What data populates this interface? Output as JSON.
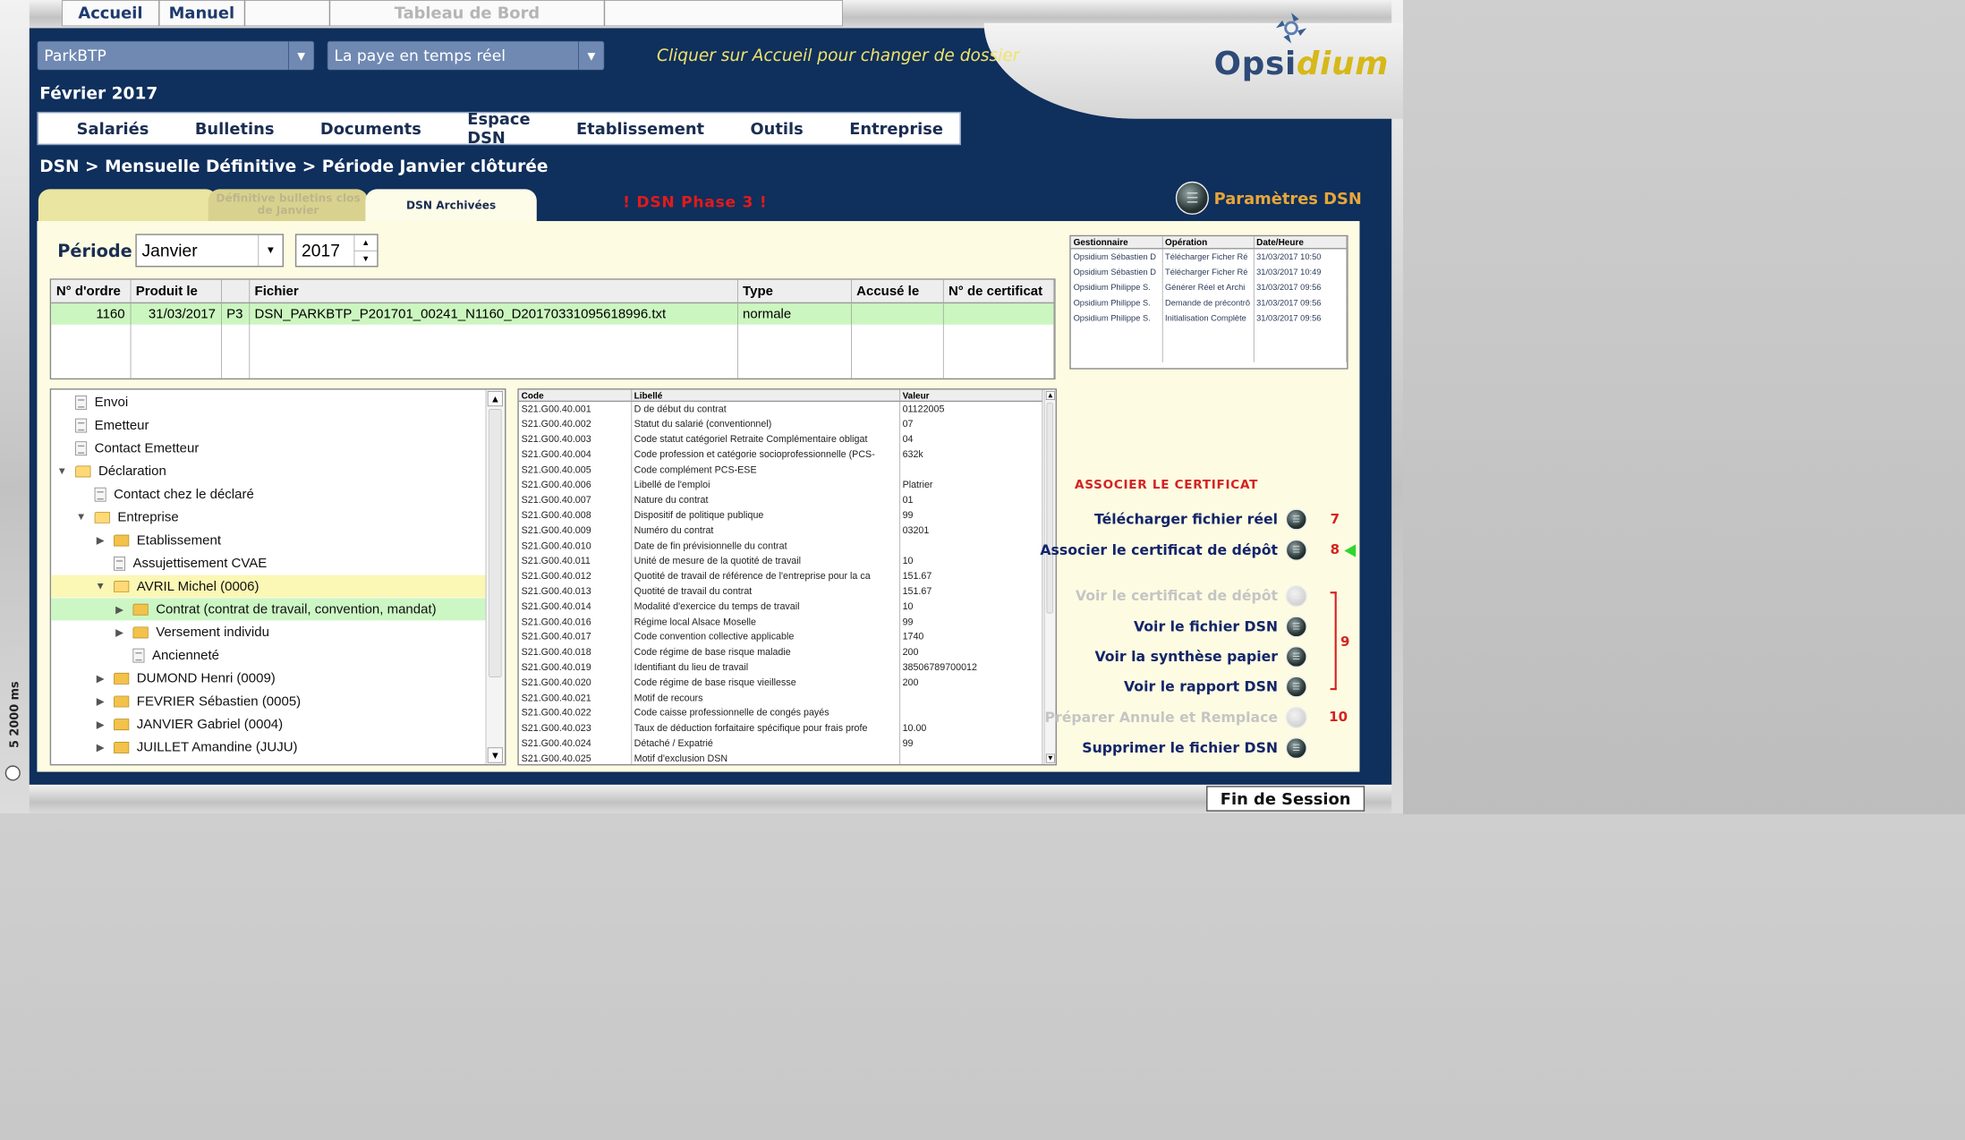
{
  "topnav": {
    "items": [
      "Accueil",
      "Manuel",
      "",
      "Tableau de Bord",
      ""
    ]
  },
  "header": {
    "dossier": "ParkBTP",
    "mode": "La paye en temps réel",
    "hint": "Cliquer sur Accueil pour changer de dossier",
    "logo_prefix": "Opsi",
    "logo_suffix": "dium",
    "date": "Février 2017"
  },
  "menu": [
    "Salariés",
    "Bulletins",
    "Documents",
    "Espace DSN",
    "Etablissement",
    "Outils",
    "Entreprise"
  ],
  "breadcrumb": "DSN > Mensuelle Définitive > Période Janvier clôturée",
  "tabs": {
    "tab1": "",
    "tab2": "Définitive bulletins clos de Janvier",
    "tab3": "DSN Archivées"
  },
  "phase": "! DSN Phase 3 !",
  "params_label": "Paramètres DSN",
  "periode": {
    "label": "Période",
    "month": "Janvier",
    "year": "2017"
  },
  "files": {
    "headers": [
      "N° d'ordre",
      "Produit le",
      "",
      "Fichier",
      "Type",
      "Accusé le",
      "N° de certificat"
    ],
    "rows": [
      [
        "1160",
        "31/03/2017",
        "P3",
        "DSN_PARKBTP_P201701_00241_N1160_D20170331095618996.txt",
        "normale",
        "",
        ""
      ]
    ]
  },
  "logs": {
    "headers": [
      "Gestionnaire",
      "Opération",
      "Date/Heure"
    ],
    "rows": [
      [
        "Opsidium Sébastien D",
        "Télécharger Ficher Ré",
        "31/03/2017 10:50"
      ],
      [
        "Opsidium Sébastien D",
        "Télécharger Ficher Ré",
        "31/03/2017 10:49"
      ],
      [
        "Opsidium Philippe S.",
        "Générer Réel et Archi",
        "31/03/2017 09:56"
      ],
      [
        "Opsidium Philippe S.",
        "Demande de précontrô",
        "31/03/2017 09:56"
      ],
      [
        "Opsidium Philippe S.",
        "Initialisation Complète",
        "31/03/2017 09:56"
      ]
    ]
  },
  "tree": [
    "Envoi",
    "Emetteur",
    "Contact Emetteur",
    "Déclaration",
    "Contact chez le déclaré",
    "Entreprise",
    "Etablissement",
    "Assujettisement CVAE",
    "AVRIL Michel (0006)",
    "Contrat (contrat de travail, convention, mandat)",
    "Versement individu",
    "Ancienneté",
    "DUMOND Henri (0009)",
    "FEVRIER Sébastien (0005)",
    "JANVIER Gabriel (0004)",
    "JUILLET Amandine (JUJU)"
  ],
  "codes": {
    "headers": [
      "Code",
      "Libellé",
      "Valeur"
    ],
    "rows": [
      [
        "S21.G00.40.001",
        "D de début du contrat",
        "01122005"
      ],
      [
        "S21.G00.40.002",
        "Statut du salarié (conventionnel)",
        "07"
      ],
      [
        "S21.G00.40.003",
        "Code statut catégoriel Retraite Complémentaire obligat",
        "04"
      ],
      [
        "S21.G00.40.004",
        "Code profession et catégorie socioprofessionnelle (PCS-",
        "632k"
      ],
      [
        "S21.G00.40.005",
        "Code complément PCS-ESE",
        ""
      ],
      [
        "S21.G00.40.006",
        "Libellé de l'emploi",
        "Platrier"
      ],
      [
        "S21.G00.40.007",
        "Nature du contrat",
        "01"
      ],
      [
        "S21.G00.40.008",
        "Dispositif de politique publique",
        "99"
      ],
      [
        "S21.G00.40.009",
        "Numéro du contrat",
        "03201"
      ],
      [
        "S21.G00.40.010",
        "Date de fin prévisionnelle du contrat",
        ""
      ],
      [
        "S21.G00.40.011",
        "Unité de mesure de la quotité de travail",
        "10"
      ],
      [
        "S21.G00.40.012",
        "Quotité de travail de référence de l'entreprise pour la ca",
        "151.67"
      ],
      [
        "S21.G00.40.013",
        "Quotité de travail du contrat",
        "151.67"
      ],
      [
        "S21.G00.40.014",
        "Modalité d'exercice du temps de travail",
        "10"
      ],
      [
        "S21.G00.40.016",
        "Régime local Alsace Moselle",
        "99"
      ],
      [
        "S21.G00.40.017",
        "Code convention collective applicable",
        "1740"
      ],
      [
        "S21.G00.40.018",
        "Code régime de base risque maladie",
        "200"
      ],
      [
        "S21.G00.40.019",
        "Identifiant du lieu de travail",
        "38506789700012"
      ],
      [
        "S21.G00.40.020",
        "Code régime de base risque vieillesse",
        "200"
      ],
      [
        "S21.G00.40.021",
        "Motif de recours",
        ""
      ],
      [
        "S21.G00.40.022",
        "Code caisse professionnelle de congés payés",
        ""
      ],
      [
        "S21.G00.40.023",
        "Taux de déduction forfaitaire spécifique pour frais profe",
        "10.00"
      ],
      [
        "S21.G00.40.024",
        "Détaché / Expatrié",
        "99"
      ],
      [
        "S21.G00.40.025",
        "Motif d'exclusion DSN",
        ""
      ]
    ]
  },
  "actions": {
    "title": "ASSOCIER LE CERTIFICAT",
    "download": "Télécharger fichier réel",
    "associate": "Associer le certificat de dépôt",
    "view_cert": "Voir le certificat de dépôt",
    "view_dsn": "Voir le fichier DSN",
    "view_paper": "Voir la synthèse papier",
    "view_report": "Voir le rapport DSN",
    "prepare": "Préparer Annule et Remplace",
    "delete": "Supprimer le fichier DSN",
    "n7": "7",
    "n8": "8",
    "n9": "9",
    "n10": "10"
  },
  "fin_session": "Fin de Session",
  "timing": "5 2000 ms",
  "colors": {
    "navy": "#0f2f5c",
    "cream": "#fdfce2",
    "selected_row": "#ccf6c0",
    "alert_red": "#d52222",
    "accent_orange": "#e7a63a"
  }
}
